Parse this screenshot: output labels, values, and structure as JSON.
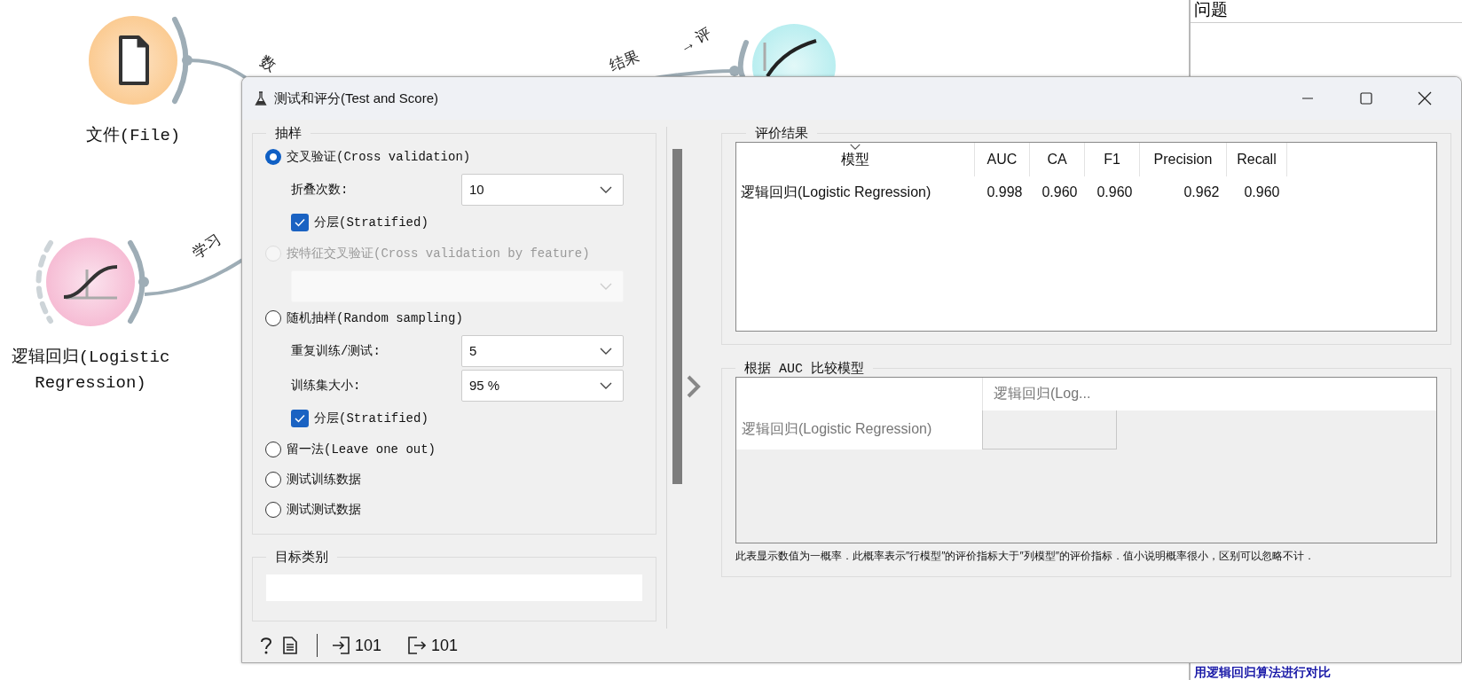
{
  "canvas": {
    "nodes": [
      {
        "kind": "file",
        "label": "文件(File)"
      },
      {
        "kind": "logistic",
        "label": "逻辑回归(Logistic Regression)"
      },
      {
        "kind": "roc"
      }
    ],
    "link_labels": [
      "数",
      "学习",
      "结果",
      "→ 评"
    ]
  },
  "background_window": {
    "heading": "问题",
    "banner": "用逻辑回归算法进行对比"
  },
  "dialog": {
    "title": "测试和评分(Test and Score)",
    "sampling": {
      "title": "抽样",
      "options": [
        {
          "label": "交叉验证(Cross validation)",
          "selected": true,
          "disabled": false,
          "settings": [
            {
              "kind": "dropdown",
              "label": "折叠次数:",
              "value": "10",
              "disabled": false
            },
            {
              "kind": "checkbox",
              "label": "分层(Stratified)",
              "checked": true
            }
          ]
        },
        {
          "label": "按特征交叉验证(Cross validation by feature)",
          "selected": false,
          "disabled": true,
          "settings": [
            {
              "kind": "dropdown",
              "disabled": true
            }
          ]
        },
        {
          "label": "随机抽样(Random sampling)",
          "selected": false,
          "disabled": false,
          "settings": [
            {
              "kind": "dropdown",
              "label": "重复训练/测试:",
              "value": "5",
              "disabled": false
            },
            {
              "kind": "dropdown",
              "label": "训练集大小:",
              "value": "95 %",
              "disabled": false
            },
            {
              "kind": "checkbox",
              "label": "分层(Stratified)",
              "checked": true
            }
          ]
        },
        {
          "label": "留一法(Leave one out)",
          "selected": false,
          "disabled": false
        },
        {
          "label": "测试训练数据",
          "selected": false,
          "disabled": false
        },
        {
          "label": "测试测试数据",
          "selected": false,
          "disabled": false
        }
      ]
    },
    "target": {
      "title": "目标类别"
    },
    "results": {
      "title": "评价结果",
      "columns": [
        {
          "label": "模型",
          "sorted": true
        },
        {
          "label": "AUC",
          "sorted": false
        },
        {
          "label": "CA",
          "sorted": false
        },
        {
          "label": "F1",
          "sorted": false
        },
        {
          "label": "Precision",
          "sorted": false
        },
        {
          "label": "Recall",
          "sorted": false
        }
      ],
      "rows": [
        [
          "逻辑回归(Logistic Regression)",
          "0.998",
          "0.960",
          "0.960",
          "0.962",
          "0.960"
        ]
      ]
    },
    "comparison": {
      "title": "根据 AUC 比较模型",
      "columns": [
        "逻辑回归(Log..."
      ],
      "rows": [
        "逻辑回归(Logistic Regression)"
      ],
      "note": "此表显示数值为一概率．此概率表示″行模型″的评价指标大于″列模型″的评价指标．值小说明概率很小，区别可以忽略不计．"
    },
    "status_bar": {
      "input_count": "101",
      "output_count": "101"
    }
  }
}
